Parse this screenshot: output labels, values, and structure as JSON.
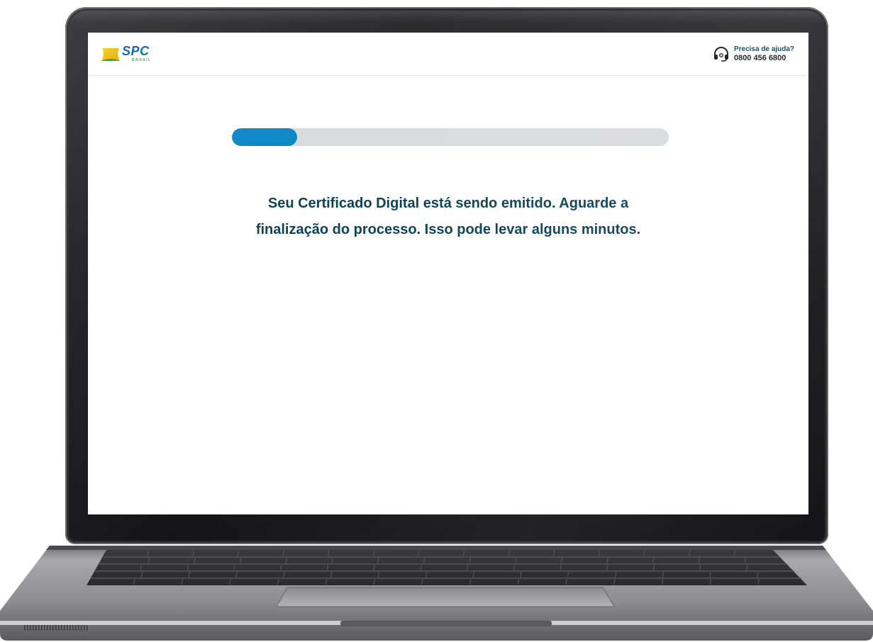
{
  "brand": {
    "name": "SPC",
    "sub": "BRASIL"
  },
  "help": {
    "label": "Precisa de ajuda?",
    "phone": "0800 456 6800",
    "icon": "headset-icon"
  },
  "progress": {
    "percent": 15
  },
  "message": {
    "line1": "Seu Certificado Digital está sendo emitido. Aguarde a",
    "line2": "finalização do processo. Isso pode levar alguns minutos."
  },
  "colors": {
    "accent": "#0b87c6",
    "track": "#dadbdd",
    "text": "#0c4256",
    "brand_blue": "#0a5fa8",
    "brand_yellow": "#f2c200"
  }
}
